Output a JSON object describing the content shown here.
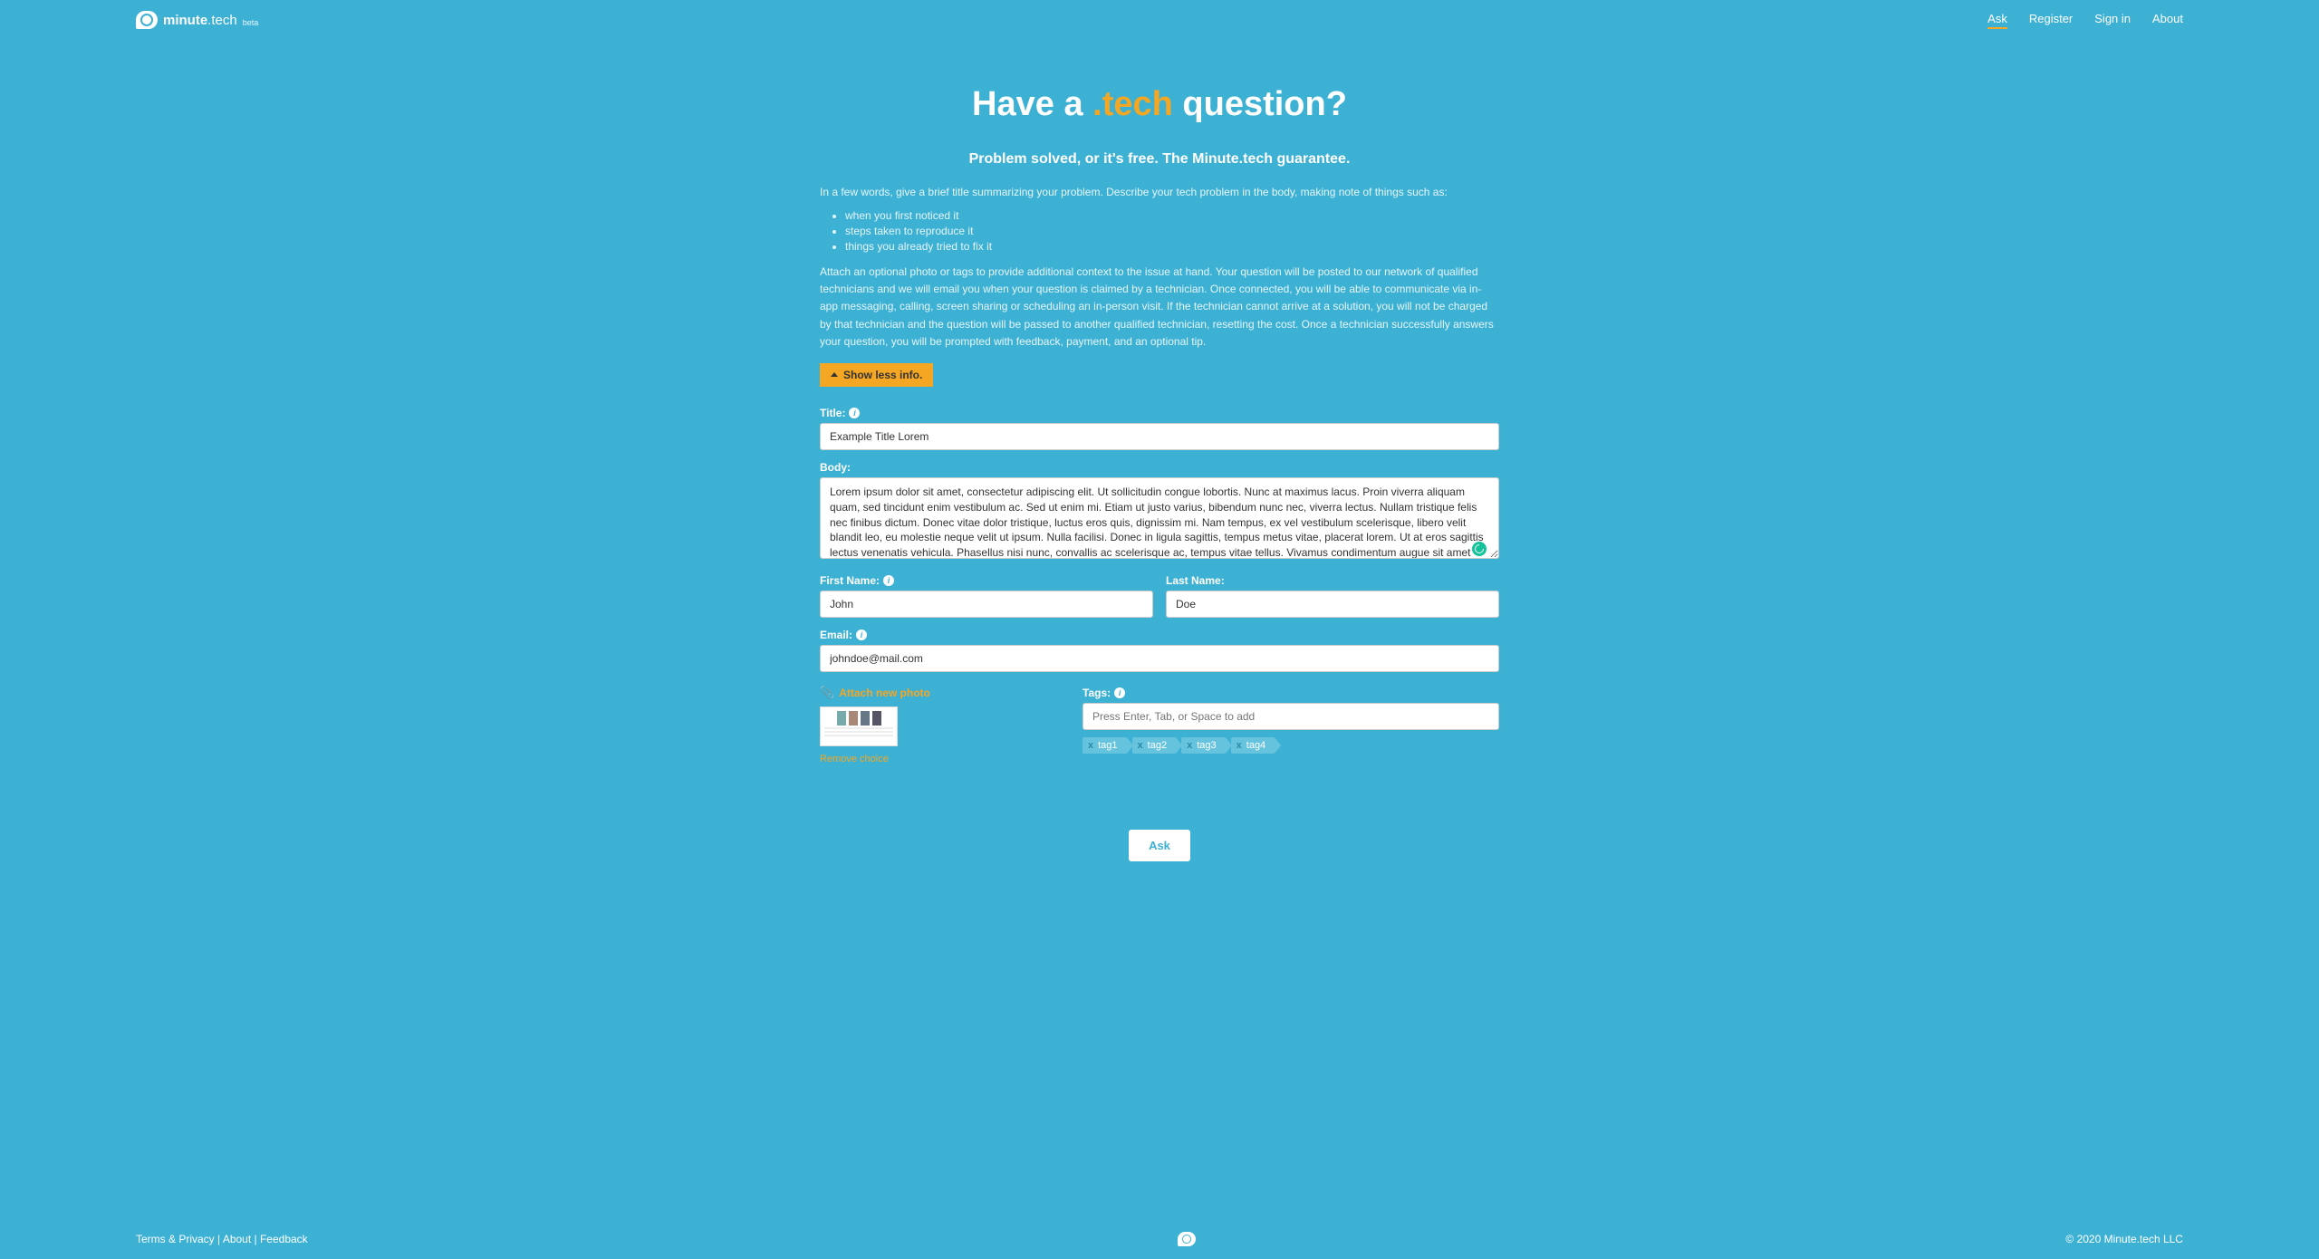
{
  "header": {
    "logo_main": "minute",
    "logo_sub": ".tech",
    "logo_badge": "beta",
    "nav": [
      "Ask",
      "Register",
      "Sign in",
      "About"
    ]
  },
  "hero": {
    "title_pre": "Have a ",
    "title_accent": ".tech",
    "title_post": " question?",
    "guarantee": "Problem solved, or it's free. The Minute.tech guarantee.",
    "intro": "In a few words, give a brief title summarizing your problem. Describe your tech problem in the body, making note of things such as:",
    "hints": [
      "when you first noticed it",
      "steps taken to reproduce it",
      "things you already tried to fix it"
    ],
    "desc": "Attach an optional photo or tags to provide additional context to the issue at hand. Your question will be posted to our network of qualified technicians and we will email you when your question is claimed by a technician. Once connected, you will be able to communicate via in-app messaging, calling, screen sharing or scheduling an in-person visit. If the technician cannot arrive at a solution, you will not be charged by that technician and the question will be passed to another qualified technician, resetting the cost. Once a technician successfully answers your question, you will be prompted with feedback, payment, and an optional tip.",
    "toggle_label": "Show less info."
  },
  "form": {
    "title_label": "Title:",
    "title_value": "Example Title Lorem",
    "body_label": "Body:",
    "body_value": "Lorem ipsum dolor sit amet, consectetur adipiscing elit. Ut sollicitudin congue lobortis. Nunc at maximus lacus. Proin viverra aliquam quam, sed tincidunt enim vestibulum ac. Sed ut enim mi. Etiam ut justo varius, bibendum nunc nec, viverra lectus. Nullam tristique felis nec finibus dictum. Donec vitae dolor tristique, luctus eros quis, dignissim mi. Nam tempus, ex vel vestibulum scelerisque, libero velit blandit leo, eu molestie neque velit ut ipsum. Nulla facilisi. Donec in ligula sagittis, tempus metus vitae, placerat lorem. Ut at eros sagittis lectus venenatis vehicula. Phasellus nisi nunc, convallis ac scelerisque ac, tempus vitae tellus. Vivamus condimentum augue sit amet massa rutrum, eget tempor eros porttitor. Aenean sed consectetur mi, non elementum purus. Aliquam erat volutpat.",
    "first_name_label": "First Name:",
    "first_name_value": "John",
    "last_name_label": "Last Name:",
    "last_name_value": "Doe",
    "email_label": "Email:",
    "email_value": "johndoe@mail.com",
    "attach_label": "Attach new photo",
    "remove_label": "Remove choice",
    "tags_label": "Tags:",
    "tags_placeholder": "Press Enter, Tab, or Space to add",
    "tags": [
      "tag1",
      "tag2",
      "tag3",
      "tag4"
    ],
    "submit_label": "Ask"
  },
  "footer": {
    "left_links": [
      "Terms & Privacy",
      "About",
      "Feedback"
    ],
    "separator": " | ",
    "copyright": "© 2020 Minute.tech LLC"
  }
}
